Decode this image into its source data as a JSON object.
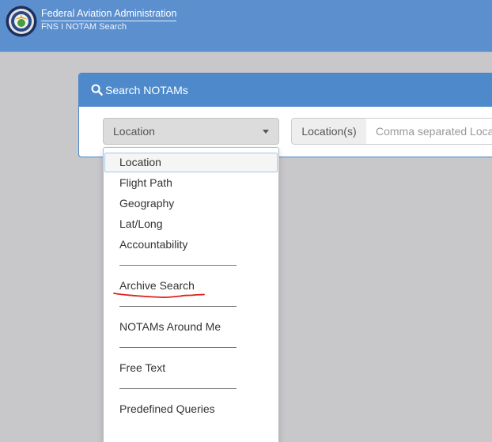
{
  "header": {
    "title": "Federal Aviation Administration",
    "subtitle": "FNS I NOTAM Search",
    "logo_icon": "faa-seal-icon"
  },
  "panel": {
    "title": "Search NOTAMs",
    "icon": "search-icon"
  },
  "search_type": {
    "selected": "Location",
    "options": [
      "Location",
      "Flight Path",
      "Geography",
      "Lat/Long",
      "Accountability",
      "Archive Search",
      "NOTAMs Around Me",
      "Free Text",
      "Predefined Queries"
    ]
  },
  "location_input": {
    "label": "Location(s)",
    "placeholder": "Comma separated Locations"
  },
  "colors": {
    "header_bg": "#5b8fce",
    "panel_heading_bg": "#4e8acb",
    "annotation_red": "#e0201c"
  }
}
